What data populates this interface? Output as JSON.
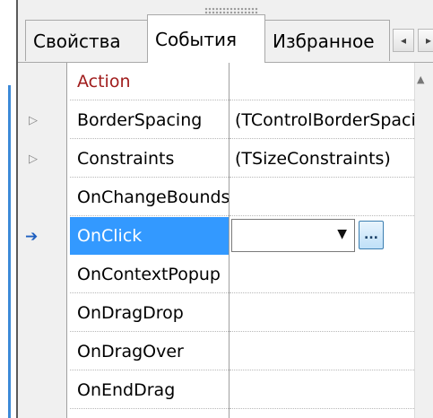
{
  "tabs": {
    "properties": "Свойства",
    "events": "События",
    "favorites": "Избранное",
    "active": "События"
  },
  "rows": [
    {
      "name": "Action",
      "value": "",
      "expander": "",
      "style": "red"
    },
    {
      "name": "BorderSpacing",
      "value": "(TControlBorderSpacing)",
      "expander": "▷"
    },
    {
      "name": "Constraints",
      "value": "(TSizeConstraints)",
      "expander": "▷"
    },
    {
      "name": "OnChangeBounds",
      "value": ""
    },
    {
      "name": "OnClick",
      "value": "",
      "selected": true,
      "current_marker": "➔"
    },
    {
      "name": "OnContextPopup",
      "value": ""
    },
    {
      "name": "OnDragDrop",
      "value": ""
    },
    {
      "name": "OnDragOver",
      "value": ""
    },
    {
      "name": "OnEndDrag",
      "value": ""
    }
  ],
  "editor": {
    "combo_value": "",
    "dropdown_icon": "▼",
    "ellipsis_label": "..."
  },
  "colors": {
    "selection": "#3399ff",
    "inherited_red": "#a01c1c",
    "current_marker": "#1e5fc0"
  },
  "icons": {
    "scroll_left": "◂",
    "scroll_right": "▸",
    "scroll_up": "▲"
  }
}
